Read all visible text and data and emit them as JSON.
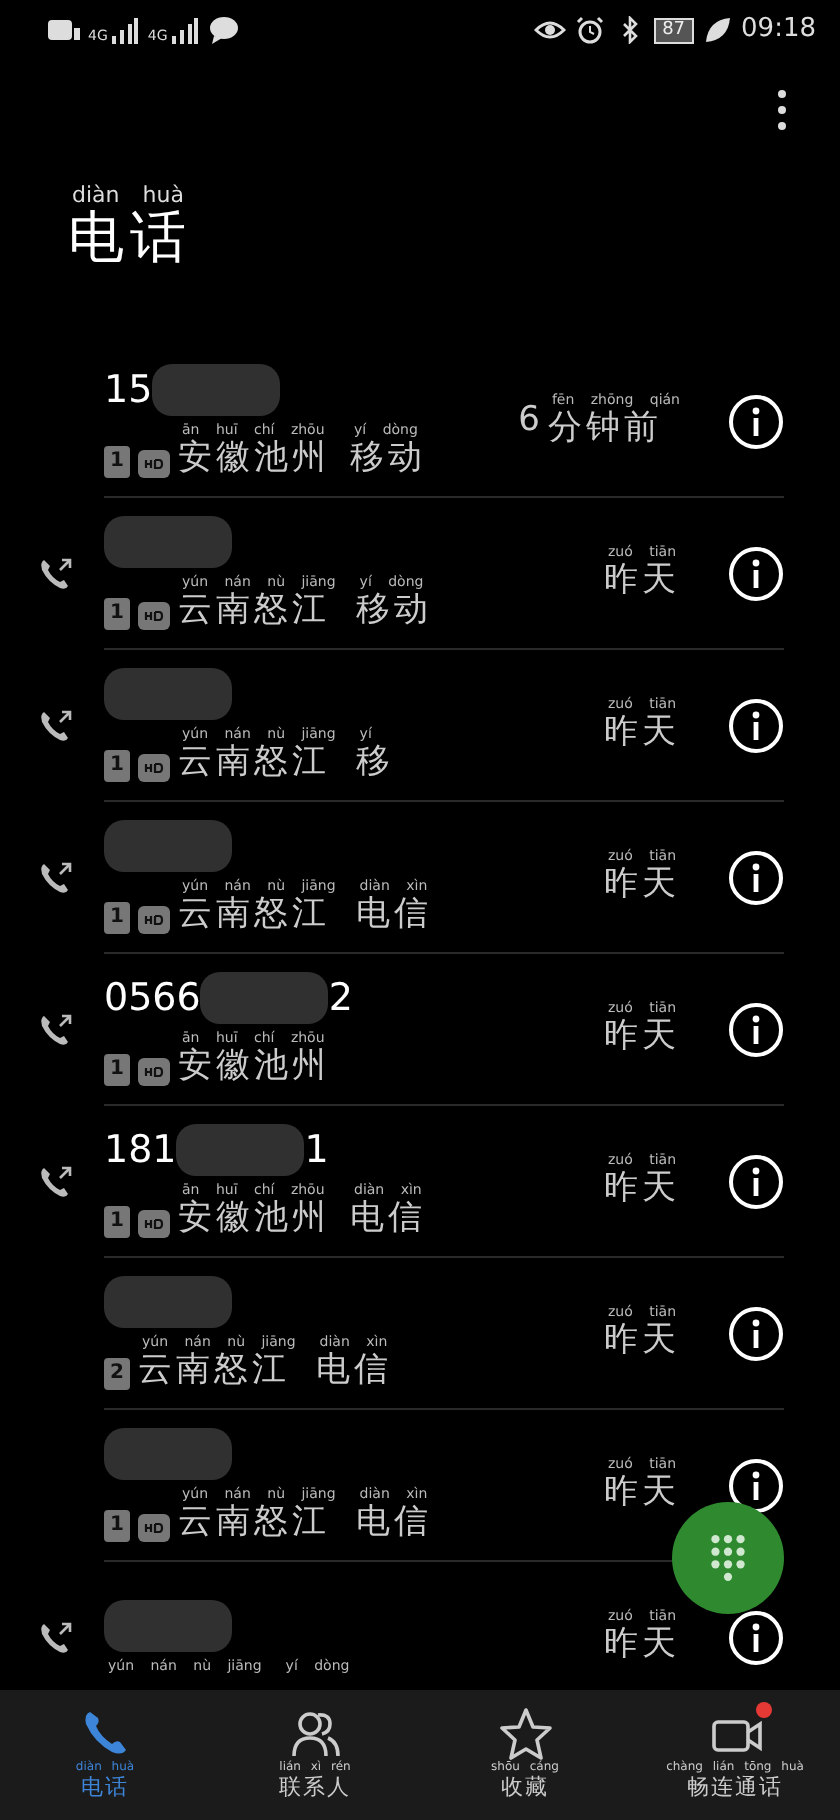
{
  "status_bar": {
    "left": [
      "4G",
      "4G"
    ],
    "battery": "87",
    "time": "09:18"
  },
  "title": {
    "chars": "电话",
    "pinyin": "diàn huà"
  },
  "calls": [
    {
      "outgoing": false,
      "number": [
        {
          "kind": "text",
          "text": "15"
        },
        {
          "kind": "blur"
        }
      ],
      "sim": "1",
      "hd": true,
      "location": [
        {
          "chars": "安徽池州",
          "pinyin": "ān huī chí zhōu"
        },
        {
          "chars": "移动",
          "pinyin": "yí dòng"
        }
      ],
      "time": {
        "prefix": "6",
        "chars": "分钟前",
        "pinyin": "fēn zhōng qián"
      }
    },
    {
      "outgoing": true,
      "number": [
        {
          "kind": "blur"
        }
      ],
      "sim": "1",
      "hd": true,
      "location": [
        {
          "chars": "云南怒江",
          "pinyin": "yún nán nù jiāng"
        },
        {
          "chars": "移动",
          "pinyin": "yí dòng"
        }
      ],
      "time": {
        "chars": "昨天",
        "pinyin": "zuó tiān"
      }
    },
    {
      "outgoing": true,
      "number": [
        {
          "kind": "blur"
        }
      ],
      "sim": "1",
      "hd": true,
      "location": [
        {
          "chars": "云南怒江",
          "pinyin": "yún nán nù jiāng"
        },
        {
          "chars": "移",
          "pinyin": "yí"
        }
      ],
      "time": {
        "chars": "昨天",
        "pinyin": "zuó tiān"
      }
    },
    {
      "outgoing": true,
      "number": [
        {
          "kind": "blur"
        }
      ],
      "sim": "1",
      "hd": true,
      "location": [
        {
          "chars": "云南怒江",
          "pinyin": "yún nán nù jiāng"
        },
        {
          "chars": "电信",
          "pinyin": "diàn xìn"
        }
      ],
      "time": {
        "chars": "昨天",
        "pinyin": "zuó tiān"
      }
    },
    {
      "outgoing": true,
      "number": [
        {
          "kind": "text",
          "text": "0566"
        },
        {
          "kind": "blur"
        },
        {
          "kind": "text",
          "text": "2"
        }
      ],
      "sim": "1",
      "hd": true,
      "location": [
        {
          "chars": "安徽池州",
          "pinyin": "ān huī chí zhōu"
        }
      ],
      "time": {
        "chars": "昨天",
        "pinyin": "zuó tiān"
      }
    },
    {
      "outgoing": true,
      "number": [
        {
          "kind": "text",
          "text": "181"
        },
        {
          "kind": "blur"
        },
        {
          "kind": "text",
          "text": "1"
        }
      ],
      "sim": "1",
      "hd": true,
      "location": [
        {
          "chars": "安徽池州",
          "pinyin": "ān huī chí zhōu"
        },
        {
          "chars": "电信",
          "pinyin": "diàn xìn"
        }
      ],
      "time": {
        "chars": "昨天",
        "pinyin": "zuó tiān"
      }
    },
    {
      "outgoing": false,
      "number": [
        {
          "kind": "blur"
        }
      ],
      "sim": "2",
      "hd": false,
      "location": [
        {
          "chars": "云南怒江",
          "pinyin": "yún nán nù jiāng"
        },
        {
          "chars": "电信",
          "pinyin": "diàn xìn"
        }
      ],
      "time": {
        "chars": "昨天",
        "pinyin": "zuó tiān"
      }
    },
    {
      "outgoing": false,
      "number": [
        {
          "kind": "blur"
        }
      ],
      "sim": "1",
      "hd": true,
      "location": [
        {
          "chars": "云南怒江",
          "pinyin": "yún nán nù jiāng"
        },
        {
          "chars": "电信",
          "pinyin": "diàn xìn"
        }
      ],
      "time": {
        "chars": "昨天",
        "pinyin": "zuó tiān"
      }
    },
    {
      "outgoing": true,
      "number": [
        {
          "kind": "blur"
        }
      ],
      "location": [
        {
          "pinyin": "yún nán nù jiāng"
        },
        {
          "pinyin": "yí dòng"
        }
      ],
      "time": {
        "chars": "昨天",
        "pinyin": "zuó tiān"
      }
    }
  ],
  "nav": [
    {
      "kind": "phone",
      "chars": "电话",
      "pinyin": "diàn huà",
      "selected": true,
      "badge": false
    },
    {
      "kind": "contacts",
      "chars": "联系人",
      "pinyin": "lián xì rén",
      "selected": false,
      "badge": false
    },
    {
      "kind": "favorites",
      "chars": "收藏",
      "pinyin": "shōu cáng",
      "selected": false,
      "badge": false
    },
    {
      "kind": "video",
      "chars": "畅连通话",
      "pinyin": "chàng lián tōng huà",
      "selected": false,
      "badge": true
    }
  ]
}
